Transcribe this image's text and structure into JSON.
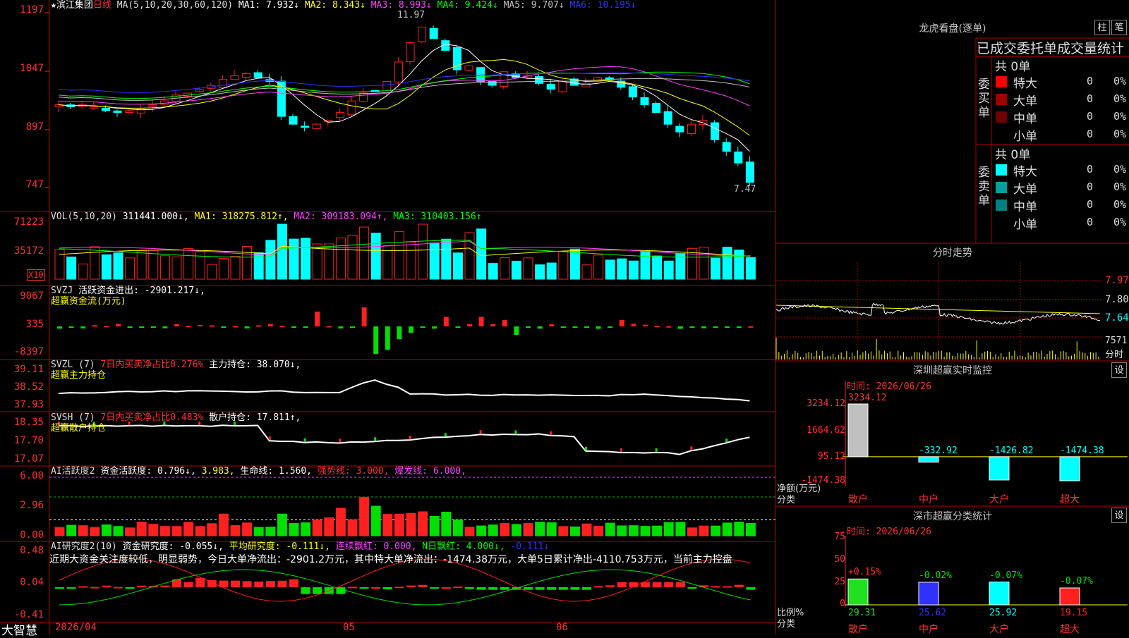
{
  "main_header": {
    "star": "★",
    "stock_name": "滨江集团",
    "period": "日线",
    "ma_label": "MA(5,10,20,30,60,120)",
    "ma1": "MA1: 7.932↓",
    "ma2": "MA2: 8.343↓",
    "ma3": "MA3: 8.993↓",
    "ma4": "MA4: 9.424↓",
    "ma5": "MA5: 9.707↓",
    "ma6": "MA6: 10.195↓"
  },
  "price_axis": [
    "1197",
    "1047",
    "897",
    "747"
  ],
  "price_marks": {
    "high": "11.97",
    "low": "7.47"
  },
  "vol_header": {
    "label": "VOL(5,10,20)",
    "value": "311441.000↓,",
    "ma1": "MA1: 318275.812↑,",
    "ma2": "MA2: 309183.094↑,",
    "ma3": "MA3: 310403.156↑"
  },
  "vol_axis": [
    "71223",
    "35172"
  ],
  "vol_unit": "X10",
  "svzj": {
    "label": "SVZJ",
    "text": "活跃资金进出: -2901.217↓,",
    "sub": "超赢资金流(万元)",
    "axis": [
      "9067",
      "335",
      "-8397"
    ]
  },
  "svzl": {
    "label": "SVZL (7)",
    "red": "7日内买卖净占比0.276%",
    "text": "主力持仓: 38.070↓,",
    "sub": "超赢主力持仓",
    "axis": [
      "39.11",
      "38.52",
      "37.93"
    ]
  },
  "svsh": {
    "label": "SVSH (7)",
    "red": "7日内买卖净占比0.483%",
    "text": "散户持仓: 17.811↑,",
    "sub": "超赢散户持仓",
    "axis": [
      "18.35",
      "17.70",
      "17.07"
    ]
  },
  "ai1": {
    "label": "AI活跃度2",
    "text1": "资金活跃度: 0.796↓,",
    "text2": "3.983,",
    "text3": "生命线: 1.560,",
    "text4": "强势线: 3.000,",
    "text5": "爆发线: 6.000,",
    "axis": [
      "6.00",
      "2.96",
      "0.00"
    ]
  },
  "ai2": {
    "label": "AI研究度2(10)",
    "t1": "资金研究度: -0.055↓,",
    "t2": "平均研究度: -0.111↓,",
    "t3": "连续飘红: 0.000,",
    "t4": "N日飘红: 4.000↓,",
    "t5": "-0.111↓",
    "desc": "近期大资金关注度较低，明显弱势，今日大单净流出：-2901.2万元，其中特大单净流出：-1474.38万元，大单5日累计净出-4110.753万元，当前主力控盘",
    "axis": [
      "0.48",
      "0.04",
      "-0.41"
    ]
  },
  "date_axis": {
    "d1": "2026/04",
    "d2": "05",
    "d3": "06"
  },
  "brand": "大智慧",
  "right": {
    "lhb_title": "龙虎看盘(逐单)",
    "btn1": "柱",
    "btn2": "笔",
    "stat_title": "已成交委托单成交量统计",
    "buy_label": "委买单",
    "sell_label": "委卖单",
    "buy_total": "共 0单",
    "sell_total": "共 0单",
    "buy_rows": [
      {
        "name": "特大",
        "val": "0",
        "pct": "0%",
        "color": "#ff0000"
      },
      {
        "name": "大单",
        "val": "0",
        "pct": "0%",
        "color": "#a00000"
      },
      {
        "name": "中单",
        "val": "0",
        "pct": "0%",
        "color": "#700000"
      },
      {
        "name": "小单",
        "val": "0",
        "pct": "0%",
        "color": "#000000"
      }
    ],
    "sell_rows": [
      {
        "name": "特大",
        "val": "0",
        "pct": "0%",
        "color": "#00ffff"
      },
      {
        "name": "大单",
        "val": "0",
        "pct": "0%",
        "color": "#00a0a0"
      },
      {
        "name": "中单",
        "val": "0",
        "pct": "0%",
        "color": "#008080"
      },
      {
        "name": "小单",
        "val": "0",
        "pct": "0%",
        "color": "#000000"
      }
    ],
    "fenshi_title": "分时走势",
    "fenshi_axis": [
      "7.97",
      "7.80",
      "7.64"
    ],
    "fenshi_vol": "7571",
    "fenshi_label": "分时",
    "sz_title": "深圳超赢实时监控",
    "set1": "设",
    "sz_time": "时间: 2026/06/26",
    "sz_axis": [
      "3234.12",
      "1664.62",
      "95.12",
      "-1474.38"
    ],
    "sz_unit": "净额(万元)",
    "sz_cat_label": "分类",
    "sz_bars": [
      {
        "name": "散户",
        "value": 3234.12,
        "label": "3234.12"
      },
      {
        "name": "中户",
        "value": -332.92,
        "label": "-332.92"
      },
      {
        "name": "大户",
        "value": -1426.82,
        "label": "-1426.82"
      },
      {
        "name": "超大",
        "value": -1474.38,
        "label": "-1474.38"
      }
    ],
    "cls_title": "深市超赢分类统计",
    "set2": "设",
    "cls_time": "时间: 2026/06/26",
    "cls_axis": [
      "75",
      "50",
      "25",
      "0"
    ],
    "cls_unit": "比例%",
    "cls_cat_label": "分类",
    "cls_bars": [
      {
        "name": "散户",
        "value": 29.31,
        "change": "+0.15%",
        "color": "#20e020"
      },
      {
        "name": "中户",
        "value": 25.62,
        "change": "-0.02%",
        "color": "#3030ff"
      },
      {
        "name": "大户",
        "value": 25.92,
        "change": "-0.07%",
        "color": "#00ffff"
      },
      {
        "name": "超大",
        "value": 19.15,
        "change": "-0.07%",
        "color": "#ff2020"
      }
    ]
  },
  "colors": {
    "up": "#ff2020",
    "down": "#00ffff",
    "grid": "#b00000"
  }
}
